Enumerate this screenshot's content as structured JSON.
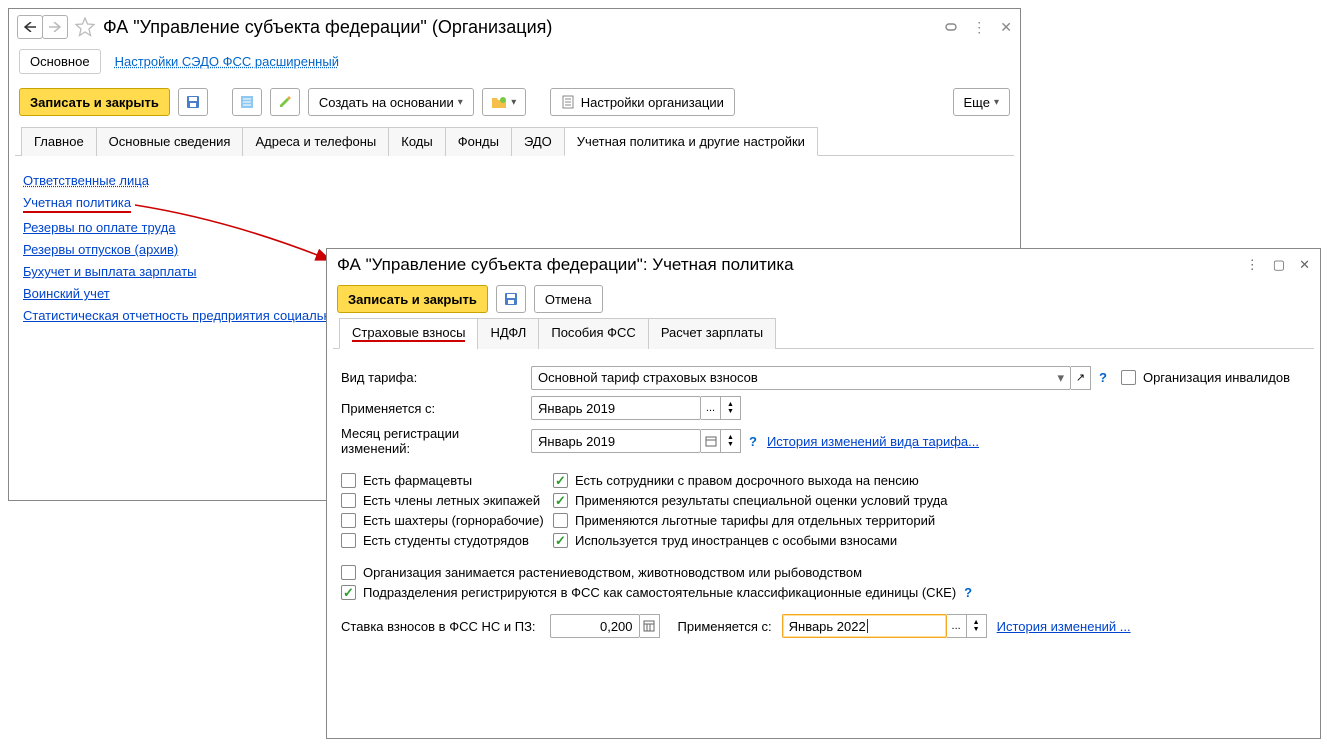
{
  "win1": {
    "title": "ФА \"Управление субъекта федерации\" (Организация)",
    "nav_section": "Основное",
    "nav_link": "Настройки СЭДО ФСС расширенный",
    "toolbar": {
      "save_close": "Записать и закрыть",
      "create_based": "Создать на основании",
      "org_settings": "Настройки организации",
      "more": "Еще"
    },
    "tabs": [
      "Главное",
      "Основные сведения",
      "Адреса и телефоны",
      "Коды",
      "Фонды",
      "ЭДО",
      "Учетная политика и другие настройки"
    ],
    "active_tab": 6,
    "links": [
      "Ответственные лица",
      "Учетная политика",
      "Резервы по оплате труда",
      "Резервы отпусков (архив)",
      "Бухучет и выплата зарплаты",
      "Воинский учет",
      "Статистическая отчетность предприятия социальн"
    ]
  },
  "win2": {
    "title": "ФА \"Управление субъекта федерации\": Учетная политика",
    "toolbar": {
      "save_close": "Записать и закрыть",
      "cancel": "Отмена"
    },
    "tabs": [
      "Страховые взносы",
      "НДФЛ",
      "Пособия ФСС",
      "Расчет зарплаты"
    ],
    "active_tab": 0,
    "form": {
      "tariff_label": "Вид тарифа:",
      "tariff_value": "Основной тариф страховых взносов",
      "disabled_org": "Организация инвалидов",
      "applies_from_label": "Применяется с:",
      "applies_from_value": "Январь 2019",
      "reg_month_label": "Месяц регистрации изменений:",
      "reg_month_value": "Январь 2019",
      "history_link": "История изменений вида тарифа...",
      "chk_pharma": "Есть фармацевты",
      "chk_flight": "Есть члены летных экипажей",
      "chk_miners": "Есть шахтеры (горнорабочие)",
      "chk_students": "Есть студенты студотрядов",
      "chk_early_pension": "Есть сотрудники с правом досрочного выхода на пенсию",
      "chk_special_assess": "Применяются результаты специальной оценки условий труда",
      "chk_regional": "Применяются льготные тарифы для отдельных территорий",
      "chk_foreign": "Используется труд иностранцев с особыми взносами",
      "chk_agri": "Организация занимается растениеводством, животноводством или рыбоводством",
      "chk_ske": "Подразделения регистрируются в ФСС как самостоятельные классификационные единицы (СКЕ)",
      "rate_label": "Ставка взносов в ФСС НС и ПЗ:",
      "rate_value": "0,200",
      "rate_applies_label": "Применяется с:",
      "rate_applies_value": "Январь 2022",
      "rate_history": "История изменений ..."
    }
  }
}
